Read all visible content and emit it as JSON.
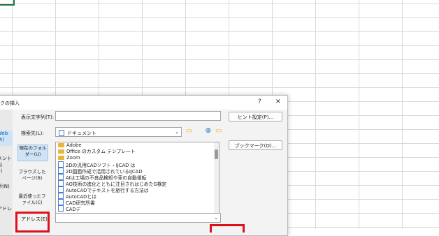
{
  "dialog": {
    "title": "クの挿入",
    "help": "?",
    "close": "✕",
    "left_pane": [
      "：",
      "Web",
      "(X)",
      "メント内",
      "E)",
      "新(N)",
      "アドレ",
      ")"
    ],
    "display_text_label": "表示文字列(T):",
    "display_text_value": "",
    "hint_button": "ヒント設定(P)...",
    "search_label": "検索先(L):",
    "search_value": "ドキュメント",
    "bookmark_button": "ブックマーク(O)...",
    "current_folder": "現在のフォルダー(U)",
    "browsed_pages": "ブラウズしたページ(B)",
    "recent_files": "最近使ったファイル(C)",
    "address_label": "アドレス(E):",
    "address_value": "",
    "files": [
      {
        "name": "Adobe",
        "type": "folder"
      },
      {
        "name": "Office のカスタム テンプレート",
        "type": "folder"
      },
      {
        "name": "Zoom",
        "type": "folder"
      },
      {
        "name": "2Dの汎用CADソフト・IJCAD は",
        "type": "doc"
      },
      {
        "name": "2D図面作成で活用されているIJCAD",
        "type": "doc"
      },
      {
        "name": "AIは工場の不良品検知や車の自動運転",
        "type": "doc"
      },
      {
        "name": "AO技術の進化とともに注目されはじめたG検定",
        "type": "doc"
      },
      {
        "name": "AutoCADでテキストを旅行する方法は",
        "type": "doc"
      },
      {
        "name": "AutoCADとは",
        "type": "doc"
      },
      {
        "name": "CAD研究所書",
        "type": "doc"
      },
      {
        "name": "CADデ",
        "type": "doc"
      }
    ]
  }
}
